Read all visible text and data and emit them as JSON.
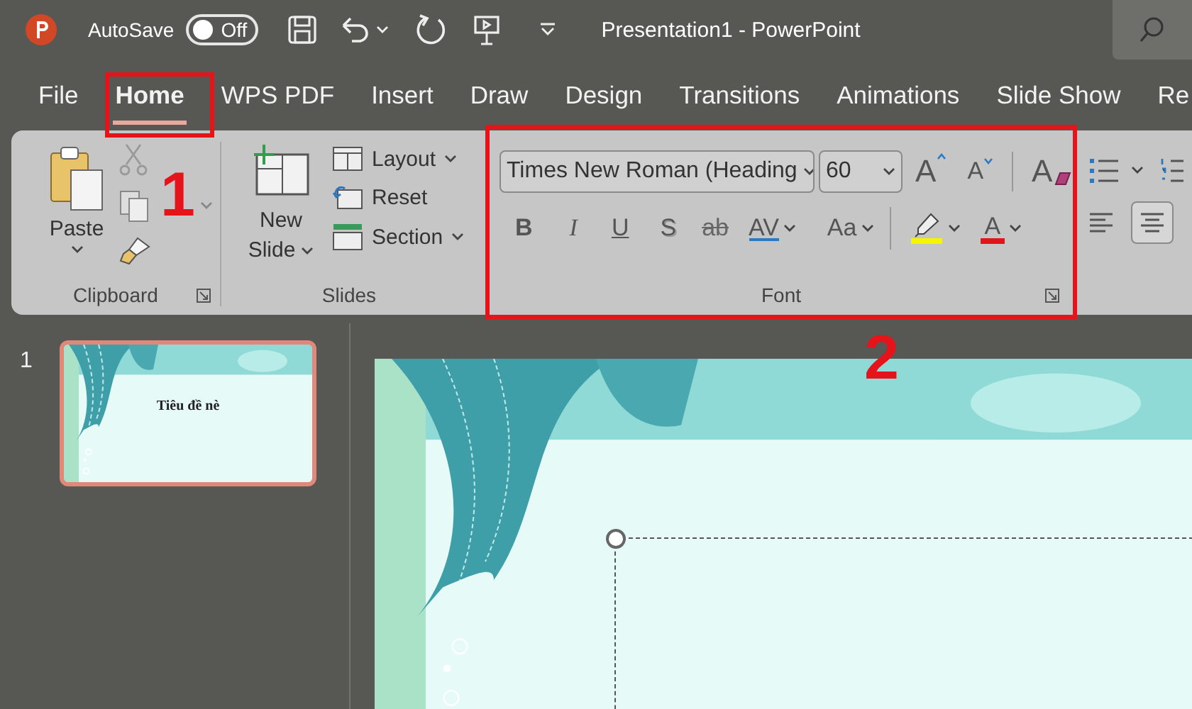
{
  "app": {
    "title": "Presentation1  -  PowerPoint"
  },
  "quick_access": {
    "autosave_label": "AutoSave",
    "autosave_toggle": {
      "on": false,
      "label": "Off"
    }
  },
  "tabs": [
    {
      "label": "File",
      "selected": false
    },
    {
      "label": "Home",
      "selected": true
    },
    {
      "label": "WPS PDF",
      "selected": false
    },
    {
      "label": "Insert",
      "selected": false
    },
    {
      "label": "Draw",
      "selected": false
    },
    {
      "label": "Design",
      "selected": false
    },
    {
      "label": "Transitions",
      "selected": false
    },
    {
      "label": "Animations",
      "selected": false
    },
    {
      "label": "Slide Show",
      "selected": false
    },
    {
      "label": "Re",
      "selected": false
    }
  ],
  "clipboard": {
    "label": "Clipboard",
    "paste": "Paste"
  },
  "slides_group": {
    "label": "Slides",
    "new_slide": "New Slide",
    "layout": "Layout",
    "reset": "Reset",
    "section": "Section"
  },
  "font": {
    "label": "Font",
    "font_name": "Times New Roman (Heading",
    "font_size": "60",
    "size_buttons": [
      {
        "kind": "grow",
        "text": "A"
      },
      {
        "kind": "shrink",
        "text": "A"
      },
      {
        "kind": "clear",
        "text": "A"
      }
    ],
    "format_buttons": [
      {
        "kind": "bold",
        "text": "B"
      },
      {
        "kind": "italic",
        "text": "I"
      },
      {
        "kind": "underline",
        "text": "U"
      },
      {
        "kind": "shadow",
        "text": "S"
      },
      {
        "kind": "strike",
        "text": "ab"
      },
      {
        "kind": "spacing",
        "text": "AV"
      },
      {
        "kind": "case",
        "text": "Aa"
      },
      {
        "kind": "highlight"
      },
      {
        "kind": "color",
        "text": "A"
      }
    ]
  },
  "paragraph": {
    "align_buttons": [
      {
        "kind": "left",
        "selected": false
      },
      {
        "kind": "center",
        "selected": true
      }
    ]
  },
  "slides_pane": {
    "thumbnails": [
      {
        "number": "1",
        "title": "Tiêu đề nè",
        "selected": true
      }
    ]
  },
  "annotations": [
    {
      "label": "1"
    },
    {
      "label": "2"
    }
  ]
}
